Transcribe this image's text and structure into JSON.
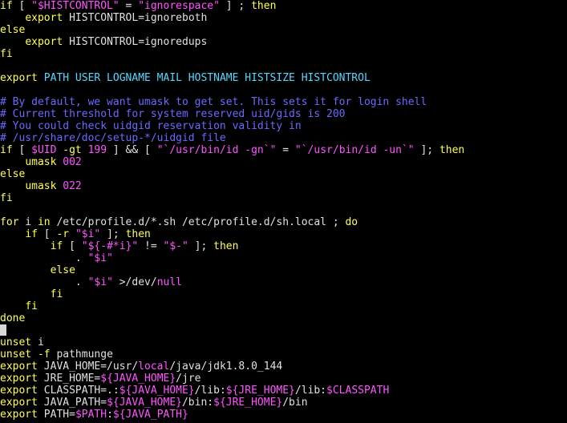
{
  "colors": {
    "background": "#000000",
    "default": "#e0e0e0",
    "keyword": "#ffff55",
    "string": "#ff55ff",
    "var": "#ff55ff",
    "comment": "#6a6aff",
    "builtin": "#55d8ff",
    "cursor": "#d8d8d8"
  },
  "lines": [
    [
      [
        "keyword",
        "if"
      ],
      [
        "default",
        " [ "
      ],
      [
        "string",
        "\""
      ],
      [
        "var",
        "$HISTCONTROL"
      ],
      [
        "string",
        "\""
      ],
      [
        "default",
        " = "
      ],
      [
        "string",
        "\"ignorespace\""
      ],
      [
        "default",
        " ] ; "
      ],
      [
        "keyword",
        "then"
      ]
    ],
    [
      [
        "default",
        "    "
      ],
      [
        "keyword",
        "export"
      ],
      [
        "default",
        " HISTCONTROL=ignoreboth"
      ]
    ],
    [
      [
        "keyword",
        "else"
      ]
    ],
    [
      [
        "default",
        "    "
      ],
      [
        "keyword",
        "export"
      ],
      [
        "default",
        " HISTCONTROL=ignoredups"
      ]
    ],
    [
      [
        "keyword",
        "fi"
      ]
    ],
    [],
    [
      [
        "keyword",
        "export"
      ],
      [
        "builtin",
        " PATH USER LOGNAME MAIL HOSTNAME HISTSIZE HISTCONTROL"
      ]
    ],
    [],
    [
      [
        "comment",
        "# By default, we want umask to get set. This sets it for login shell"
      ]
    ],
    [
      [
        "comment",
        "# Current threshold for system reserved uid/gids is 200"
      ]
    ],
    [
      [
        "comment",
        "# You could check uidgid reservation validity in"
      ]
    ],
    [
      [
        "comment",
        "# /usr/share/doc/setup-*/uidgid file"
      ]
    ],
    [
      [
        "keyword",
        "if"
      ],
      [
        "default",
        " [ "
      ],
      [
        "var",
        "$UID"
      ],
      [
        "default",
        " "
      ],
      [
        "keyword",
        "-gt"
      ],
      [
        "default",
        " "
      ],
      [
        "string",
        "199"
      ],
      [
        "default",
        " ] && [ "
      ],
      [
        "string",
        "\"`/usr/bin/id -gn`\""
      ],
      [
        "default",
        " = "
      ],
      [
        "string",
        "\"`/usr/bin/id -un`\""
      ],
      [
        "default",
        " ]; "
      ],
      [
        "keyword",
        "then"
      ]
    ],
    [
      [
        "default",
        "    "
      ],
      [
        "keyword",
        "umask"
      ],
      [
        "default",
        " "
      ],
      [
        "string",
        "002"
      ]
    ],
    [
      [
        "keyword",
        "else"
      ]
    ],
    [
      [
        "default",
        "    "
      ],
      [
        "keyword",
        "umask"
      ],
      [
        "default",
        " "
      ],
      [
        "string",
        "022"
      ]
    ],
    [
      [
        "keyword",
        "fi"
      ]
    ],
    [],
    [
      [
        "keyword",
        "for"
      ],
      [
        "default",
        " i "
      ],
      [
        "keyword",
        "in"
      ],
      [
        "default",
        " /etc/profile.d/*.sh /etc/profile.d/sh.local ; "
      ],
      [
        "keyword",
        "do"
      ]
    ],
    [
      [
        "default",
        "    "
      ],
      [
        "keyword",
        "if"
      ],
      [
        "default",
        " [ "
      ],
      [
        "keyword",
        "-r"
      ],
      [
        "default",
        " "
      ],
      [
        "string",
        "\""
      ],
      [
        "var",
        "$i"
      ],
      [
        "string",
        "\""
      ],
      [
        "default",
        " ]; "
      ],
      [
        "keyword",
        "then"
      ]
    ],
    [
      [
        "default",
        "        "
      ],
      [
        "keyword",
        "if"
      ],
      [
        "default",
        " [ "
      ],
      [
        "string",
        "\""
      ],
      [
        "var",
        "${-#*i}"
      ],
      [
        "string",
        "\""
      ],
      [
        "default",
        " != "
      ],
      [
        "string",
        "\""
      ],
      [
        "var",
        "$-"
      ],
      [
        "string",
        "\""
      ],
      [
        "default",
        " ]; "
      ],
      [
        "keyword",
        "then"
      ]
    ],
    [
      [
        "default",
        "            . "
      ],
      [
        "string",
        "\""
      ],
      [
        "var",
        "$i"
      ],
      [
        "string",
        "\""
      ]
    ],
    [
      [
        "default",
        "        "
      ],
      [
        "keyword",
        "else"
      ]
    ],
    [
      [
        "default",
        "            . "
      ],
      [
        "string",
        "\""
      ],
      [
        "var",
        "$i"
      ],
      [
        "string",
        "\""
      ],
      [
        "default",
        " >/dev/"
      ],
      [
        "var",
        "null"
      ]
    ],
    [
      [
        "default",
        "        "
      ],
      [
        "keyword",
        "fi"
      ]
    ],
    [
      [
        "default",
        "    "
      ],
      [
        "keyword",
        "fi"
      ]
    ],
    [
      [
        "keyword",
        "done"
      ]
    ],
    [
      [
        "cursor",
        ""
      ]
    ],
    [
      [
        "keyword",
        "unset"
      ],
      [
        "default",
        " i"
      ]
    ],
    [
      [
        "keyword",
        "unset"
      ],
      [
        "default",
        " "
      ],
      [
        "keyword",
        "-f"
      ],
      [
        "default",
        " pathmunge"
      ]
    ],
    [
      [
        "keyword",
        "export"
      ],
      [
        "default",
        " JAVA_HOME=/usr/"
      ],
      [
        "var",
        "local"
      ],
      [
        "default",
        "/java/jdk1.8.0_144"
      ]
    ],
    [
      [
        "keyword",
        "export"
      ],
      [
        "default",
        " JRE_HOME="
      ],
      [
        "var",
        "${JAVA_HOME}"
      ],
      [
        "default",
        "/jre"
      ]
    ],
    [
      [
        "keyword",
        "export"
      ],
      [
        "default",
        " CLASSPATH=.:"
      ],
      [
        "var",
        "${JAVA_HOME}"
      ],
      [
        "default",
        "/lib:"
      ],
      [
        "var",
        "${JRE_HOME}"
      ],
      [
        "default",
        "/lib:"
      ],
      [
        "var",
        "$CLASSPATH"
      ]
    ],
    [
      [
        "keyword",
        "export"
      ],
      [
        "default",
        " JAVA_PATH="
      ],
      [
        "var",
        "${JAVA_HOME}"
      ],
      [
        "default",
        "/bin:"
      ],
      [
        "var",
        "${JRE_HOME}"
      ],
      [
        "default",
        "/bin"
      ]
    ],
    [
      [
        "keyword",
        "export"
      ],
      [
        "default",
        " PATH="
      ],
      [
        "var",
        "$PATH"
      ],
      [
        "default",
        ":"
      ],
      [
        "var",
        "${JAVA_PATH}"
      ]
    ]
  ]
}
